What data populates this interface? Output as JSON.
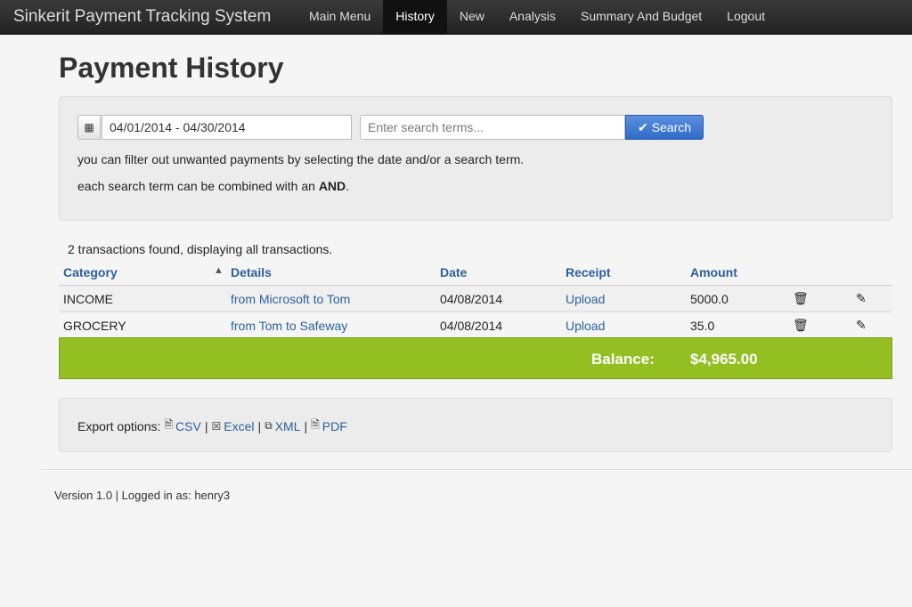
{
  "app": {
    "brand": "Sinkerit Payment Tracking System"
  },
  "nav": {
    "items": [
      {
        "label": "Main Menu"
      },
      {
        "label": "History"
      },
      {
        "label": "New"
      },
      {
        "label": "Analysis"
      },
      {
        "label": "Summary And Budget"
      },
      {
        "label": "Logout"
      }
    ],
    "active": "History"
  },
  "page": {
    "title": "Payment History"
  },
  "filter": {
    "date_range": "04/01/2014 - 04/30/2014",
    "search_placeholder": "Enter search terms...",
    "search_value": "",
    "search_button": "Search",
    "help_line1": "you can filter out unwanted payments by selecting the date and/or a search term.",
    "help_line2_prefix": "each search term can be combined with an ",
    "help_line2_bold": "AND",
    "help_line2_suffix": "."
  },
  "results": {
    "summary": "2 transactions found, displaying all transactions.",
    "columns": {
      "category": "Category",
      "details": "Details",
      "date": "Date",
      "receipt": "Receipt",
      "amount": "Amount"
    },
    "rows": [
      {
        "category": "INCOME",
        "details": "from Microsoft to Tom",
        "date": "04/08/2014",
        "receipt": "Upload",
        "amount": "5000.0"
      },
      {
        "category": "GROCERY",
        "details": "from Tom to Safeway",
        "date": "04/08/2014",
        "receipt": "Upload",
        "amount": "35.0"
      }
    ],
    "balance_label": "Balance:",
    "balance_value": "$4,965.00"
  },
  "export": {
    "label": "Export options:",
    "csv": "CSV",
    "excel": "Excel",
    "xml": "XML",
    "pdf": "PDF",
    "separator": "|"
  },
  "footer": {
    "text": "Version 1.0 | Logged in as: henry3"
  },
  "colors": {
    "accent": "#2a5f9e",
    "balance_bar": "#93bf22",
    "search_button": "#3a75d0"
  }
}
